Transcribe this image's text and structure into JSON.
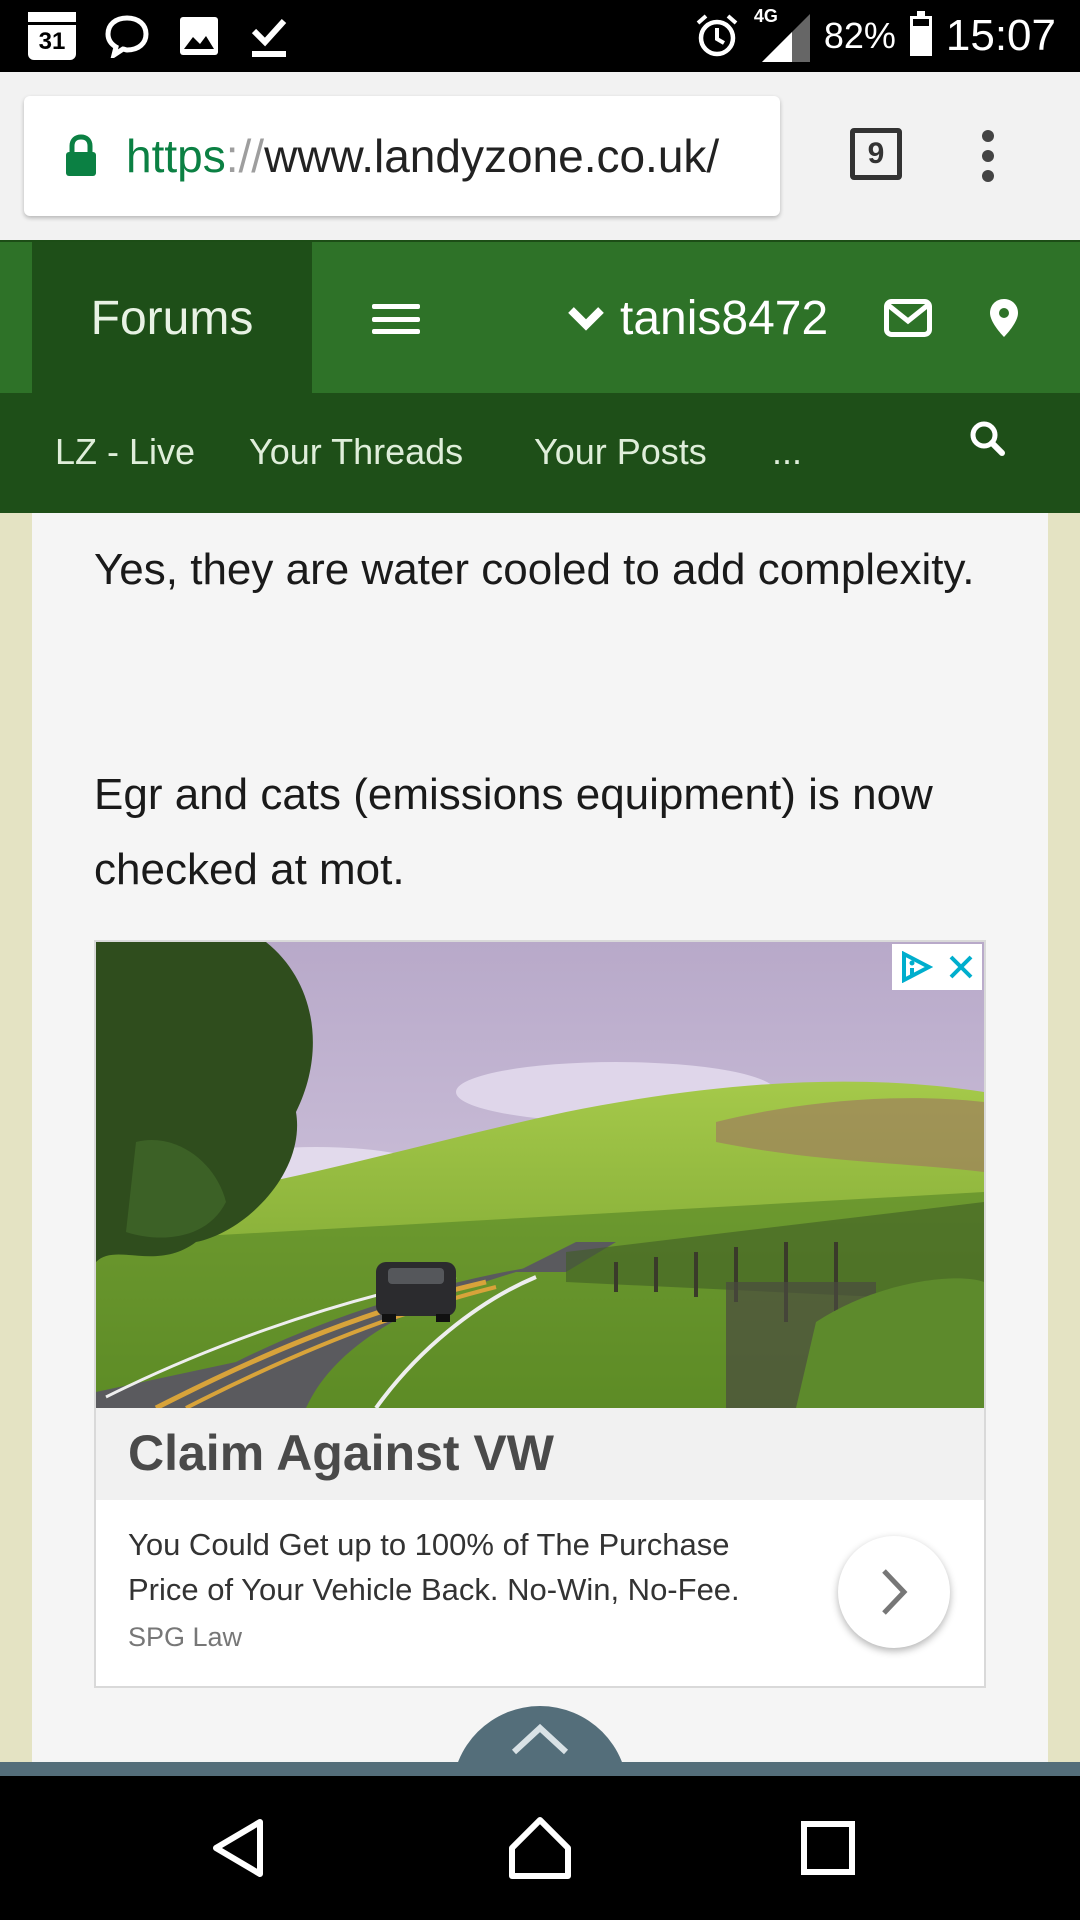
{
  "status_bar": {
    "calendar_day": "31",
    "network": "4G",
    "battery": "82%",
    "time": "15:07",
    "icons": [
      "calendar-icon",
      "chat-bubble-icon",
      "image-icon",
      "download-done-icon",
      "alarm-icon",
      "signal-icon",
      "battery-icon"
    ]
  },
  "browser": {
    "url_scheme": "https",
    "url_sep": "://",
    "url_host": "www.landyzone.co.uk/",
    "tab_count": "9",
    "icons": [
      "lock-icon",
      "overflow-menu-icon"
    ]
  },
  "site_nav": {
    "forums_label": "Forums",
    "username": "tanis8472",
    "icons": [
      "hamburger-icon",
      "chevron-down-icon",
      "mail-icon",
      "location-pin-icon"
    ]
  },
  "sub_nav": {
    "items": [
      "LZ - Live",
      "Your Threads",
      "Your Posts",
      "..."
    ],
    "icons": [
      "search-icon"
    ]
  },
  "post": {
    "paragraphs": [
      "Yes, they are water cooled to add complexity.",
      "Egr and cats (emissions equipment) is now checked at mot."
    ]
  },
  "ad": {
    "title": "Claim Against VW",
    "description": "You Could Get up to 100% of The Purchase Price of Your Vehicle Back. No-Win, No-Fee.",
    "source": "SPG Law",
    "icons": [
      "adchoices-icon",
      "close-icon",
      "chevron-right-icon"
    ]
  },
  "colors": {
    "nav_green": "#2e7228",
    "nav_dark_green": "#1e4f18",
    "url_green": "#0b8043",
    "page_bg": "#e4e3c3",
    "slate": "#546e7a"
  },
  "bottom": {
    "icons": [
      "chevron-up-icon",
      "back-icon",
      "home-icon",
      "recents-icon"
    ]
  }
}
